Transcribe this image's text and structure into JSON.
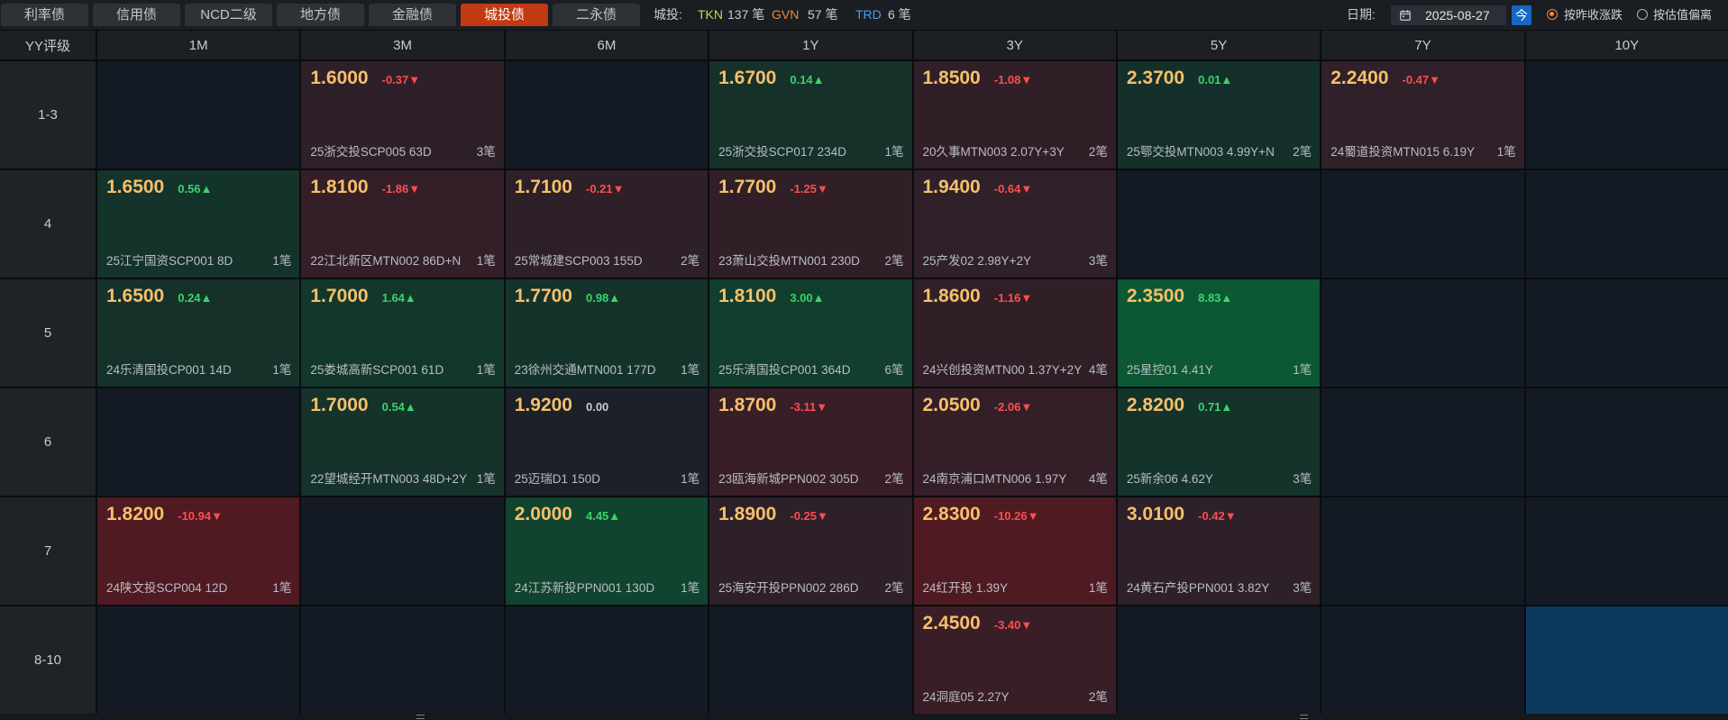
{
  "tabs": [
    {
      "label": "利率债",
      "active": false
    },
    {
      "label": "信用债",
      "active": false
    },
    {
      "label": "NCD二级",
      "active": false
    },
    {
      "label": "地方债",
      "active": false
    },
    {
      "label": "金融债",
      "active": false
    },
    {
      "label": "城投债",
      "active": true
    },
    {
      "label": "二永债",
      "active": false
    }
  ],
  "summary": {
    "label": "城投:",
    "sources": [
      {
        "code": "TKN",
        "count": "137 笔",
        "color": "#c6d84a"
      },
      {
        "code": "GVN",
        "count": "57 笔",
        "color": "#f0873a"
      },
      {
        "code": "TRD",
        "count": "6 笔",
        "color": "#4f9ef0"
      }
    ]
  },
  "date": {
    "label": "日期:",
    "value": "2025-08-27",
    "today_label": "今",
    "icon": "calendar-icon"
  },
  "modes": [
    {
      "label": "按昨收涨跌",
      "selected": true
    },
    {
      "label": "按估值偏离",
      "selected": false
    }
  ],
  "colors": {
    "up": "#3ad46a",
    "down": "#ff4d4f",
    "flat": "#c8ccd1",
    "price": "#f4c06a",
    "accent": "#c23a12",
    "selected": "#0b3a5e",
    "radio_on": "#f08a3c"
  },
  "grid": {
    "corner_label": "YY评级",
    "tenors": [
      "1M",
      "3M",
      "6M",
      "1Y",
      "3Y",
      "5Y",
      "7Y",
      "10Y"
    ],
    "rows": [
      {
        "rating": "1-3",
        "cells": [
          null,
          {
            "yield": "1.6000",
            "change": "-0.37▼",
            "bond": "25浙交投SCP005 63D",
            "trades": "3笔"
          },
          null,
          {
            "yield": "1.6700",
            "change": "0.14▲",
            "bond": "25浙交投SCP017 234D",
            "trades": "1笔"
          },
          {
            "yield": "1.8500",
            "change": "-1.08▼",
            "bond": "20久事MTN003 2.07Y+3Y",
            "trades": "2笔"
          },
          {
            "yield": "2.3700",
            "change": "0.01▲",
            "bond": "25鄂交投MTN003 4.99Y+N",
            "trades": "2笔"
          },
          {
            "yield": "2.2400",
            "change": "-0.47▼",
            "bond": "24蜀道投资MTN015 6.19Y",
            "trades": "1笔"
          },
          null
        ]
      },
      {
        "rating": "4",
        "cells": [
          {
            "yield": "1.6500",
            "change": "0.56▲",
            "bond": "25江宁国资SCP001 8D",
            "trades": "1笔"
          },
          {
            "yield": "1.8100",
            "change": "-1.86▼",
            "bond": "22江北新区MTN002 86D+N",
            "trades": "1笔"
          },
          {
            "yield": "1.7100",
            "change": "-0.21▼",
            "bond": "25常城建SCP003 155D",
            "trades": "2笔"
          },
          {
            "yield": "1.7700",
            "change": "-1.25▼",
            "bond": "23萧山交投MTN001 230D",
            "trades": "2笔"
          },
          {
            "yield": "1.9400",
            "change": "-0.64▼",
            "bond": "25产发02 2.98Y+2Y",
            "trades": "3笔"
          },
          null,
          null,
          null
        ]
      },
      {
        "rating": "5",
        "cells": [
          {
            "yield": "1.6500",
            "change": "0.24▲",
            "bond": "24乐清国投CP001 14D",
            "trades": "1笔"
          },
          {
            "yield": "1.7000",
            "change": "1.64▲",
            "bond": "25娄城高新SCP001 61D",
            "trades": "1笔"
          },
          {
            "yield": "1.7700",
            "change": "0.98▲",
            "bond": "23徐州交通MTN001 177D",
            "trades": "1笔"
          },
          {
            "yield": "1.8100",
            "change": "3.00▲",
            "bond": "25乐清国投CP001 364D",
            "trades": "6笔"
          },
          {
            "yield": "1.8600",
            "change": "-1.16▼",
            "bond": "24兴创投资MTN00 1.37Y+2Y",
            "trades": "4笔"
          },
          {
            "yield": "2.3500",
            "change": "8.83▲",
            "bond": "25星控01 4.41Y",
            "trades": "1笔"
          },
          null,
          null
        ]
      },
      {
        "rating": "6",
        "cells": [
          null,
          {
            "yield": "1.7000",
            "change": "0.54▲",
            "bond": "22望城经开MTN003 48D+2Y",
            "trades": "1笔"
          },
          {
            "yield": "1.9200",
            "change": "0.00",
            "bond": "25迈瑞D1 150D",
            "trades": "1笔"
          },
          {
            "yield": "1.8700",
            "change": "-3.11▼",
            "bond": "23瓯海新城PPN002 305D",
            "trades": "2笔"
          },
          {
            "yield": "2.0500",
            "change": "-2.06▼",
            "bond": "24南京浦口MTN006 1.97Y",
            "trades": "4笔"
          },
          {
            "yield": "2.8200",
            "change": "0.71▲",
            "bond": "25新余06 4.62Y",
            "trades": "3笔"
          },
          null,
          null
        ]
      },
      {
        "rating": "7",
        "cells": [
          {
            "yield": "1.8200",
            "change": "-10.94▼",
            "bond": "24陕文投SCP004 12D",
            "trades": "1笔"
          },
          null,
          {
            "yield": "2.0000",
            "change": "4.45▲",
            "bond": "24江苏新投PPN001 130D",
            "trades": "1笔"
          },
          {
            "yield": "1.8900",
            "change": "-0.25▼",
            "bond": "25海安开投PPN002 286D",
            "trades": "2笔"
          },
          {
            "yield": "2.8300",
            "change": "-10.26▼",
            "bond": "24红开投 1.39Y",
            "trades": "1笔"
          },
          {
            "yield": "3.0100",
            "change": "-0.42▼",
            "bond": "24黄石产投PPN001 3.82Y",
            "trades": "3笔"
          },
          null,
          null
        ]
      },
      {
        "rating": "8-10",
        "cells": [
          null,
          null,
          null,
          null,
          {
            "yield": "2.4500",
            "change": "-3.40▼",
            "bond": "24洞庭05 2.27Y",
            "trades": "2笔"
          },
          null,
          null,
          {
            "selected": true
          }
        ]
      }
    ]
  }
}
